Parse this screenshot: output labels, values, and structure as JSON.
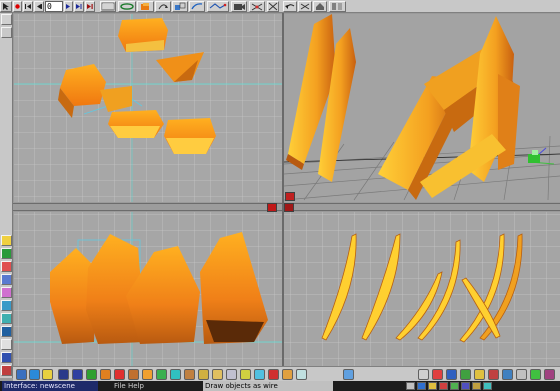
{
  "toolbar": {
    "frame_value": "0",
    "buttons": [
      "tool-select-icon",
      "record-icon",
      "go-to-start-icon",
      "step-back-icon",
      "step-forward-icon",
      "go-to-end-icon",
      "timeline-icon",
      "link-icon",
      "move-icon",
      "rotate-icon",
      "scale-icon",
      "bend-icon",
      "render-icon",
      "camera-icon",
      "zoom-icon",
      "grid-toggle-icon",
      "object-list-icon"
    ]
  },
  "left_tools": [
    "select-tool-icon",
    "view-toggle-icon",
    "color-icon",
    "texture-icon",
    "light-icon",
    "paint-icon",
    "material-icon",
    "smooth-icon",
    "cloud-icon",
    "eye-icon"
  ],
  "viewports": [
    {
      "id": "top",
      "name": "top-viewport"
    },
    {
      "id": "perspective",
      "name": "perspective-viewport"
    },
    {
      "id": "front",
      "name": "front-viewport"
    },
    {
      "id": "side",
      "name": "side-viewport"
    }
  ],
  "bottom_tools": [
    "sphere-icon",
    "cube-icon",
    "cylinder-icon",
    "cone-icon",
    "torus-icon",
    "plane-icon",
    "text-icon",
    "spline-icon",
    "lathe-icon",
    "extrude-icon",
    "skin-icon",
    "boolean-icon",
    "deform-icon",
    "cloth-icon",
    "particle-icon",
    "light-bulb-icon",
    "camera-add-icon",
    "figure-icon",
    "bone-icon",
    "glass-icon",
    "render-preview-icon"
  ],
  "status": {
    "interface": "Interface: newscene",
    "menu_file": "File",
    "menu_help": "Help",
    "message": "Draw objects as wire"
  },
  "colors": {
    "object_orange": "#f0a020",
    "object_highlight": "#ffcc30",
    "object_shade": "#b85a10",
    "grid_line": "#c9c9c9",
    "axis_cyan": "#6ce8d8",
    "status_dark": "#1c1c1c"
  }
}
